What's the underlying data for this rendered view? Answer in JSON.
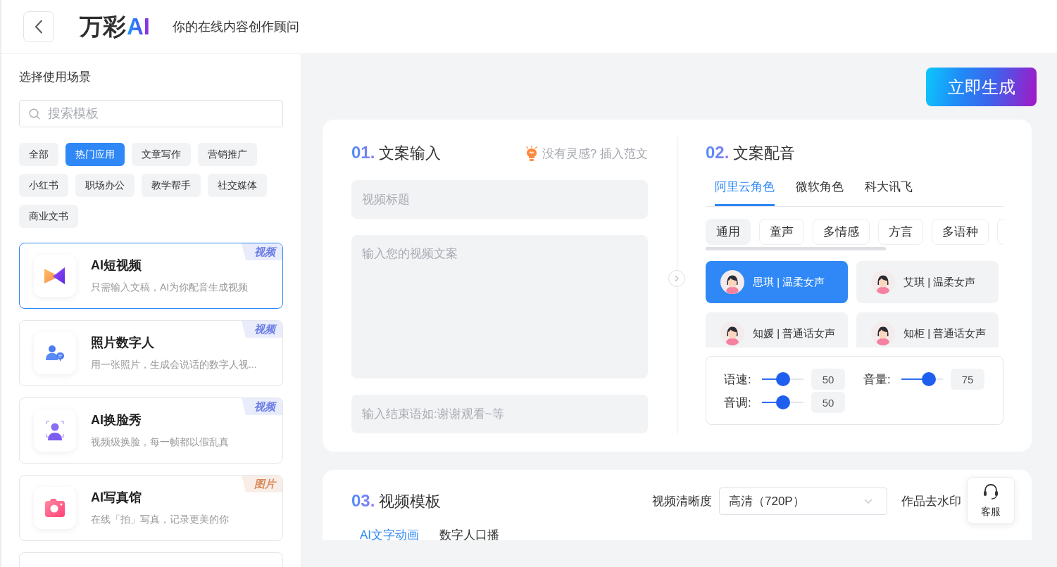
{
  "header": {
    "logo": {
      "name": "万彩",
      "mark": "AI"
    },
    "tagline": "你的在线内容创作顾问"
  },
  "sidebar": {
    "title": "选择使用场景",
    "search": {
      "placeholder": "搜索模板"
    },
    "filters": [
      {
        "label": "全部",
        "selected": false
      },
      {
        "label": "热门应用",
        "selected": true
      },
      {
        "label": "文章写作",
        "selected": false
      },
      {
        "label": "营销推广",
        "selected": false
      },
      {
        "label": "小红书",
        "selected": false
      },
      {
        "label": "职场办公",
        "selected": false
      },
      {
        "label": "教学帮手",
        "selected": false
      },
      {
        "label": "社交媒体",
        "selected": false
      },
      {
        "label": "商业文书",
        "selected": false
      }
    ],
    "templates": [
      {
        "title": "AI短视频",
        "description": "只需输入文稿，AI为你配音生成视频",
        "badge": {
          "text": "视频",
          "color": "#6a7de6"
        },
        "selected": true
      },
      {
        "title": "照片数字人",
        "description": "用一张照片，生成会说话的数字人视...",
        "badge": {
          "text": "视频",
          "color": "#6a7de6"
        },
        "selected": false
      },
      {
        "title": "AI换脸秀",
        "description": "视频级换脸，每一帧都以假乱真",
        "badge": {
          "text": "视频",
          "color": "#6a7de6"
        },
        "selected": false
      },
      {
        "title": "AI写真馆",
        "description": "在线「拍」写真，记录更美的你",
        "badge": {
          "text": "图片",
          "color": "#d98b5c"
        },
        "selected": false
      }
    ]
  },
  "generate_button": "立即生成",
  "copy_input": {
    "step": "01.",
    "title": "文案输入",
    "hint": "没有灵感? 插入范文",
    "fields": [
      {
        "kind": "input",
        "placeholder": "视频标题"
      },
      {
        "kind": "textarea",
        "placeholder": "输入您的视频文案"
      },
      {
        "kind": "input",
        "placeholder": "输入结束语如:谢谢观看~等"
      }
    ]
  },
  "dubbing": {
    "step": "02.",
    "title": "文案配音",
    "providers": [
      {
        "label": "阿里云角色",
        "selected": true
      },
      {
        "label": "微软角色",
        "selected": false
      },
      {
        "label": "科大讯飞",
        "selected": false
      }
    ],
    "categories": [
      {
        "label": "通用",
        "selected": true
      },
      {
        "label": "童声",
        "selected": false
      },
      {
        "label": "多情感",
        "selected": false
      },
      {
        "label": "方言",
        "selected": false
      },
      {
        "label": "多语种",
        "selected": false
      }
    ],
    "voices": [
      {
        "name": "思琪 | 温柔女声",
        "selected": true
      },
      {
        "name": "艾琪 | 温柔女声",
        "selected": false
      },
      {
        "name": "知媛 | 普通话女声",
        "selected": false
      },
      {
        "name": "知柜 | 普通话女声",
        "selected": false
      }
    ],
    "sliders": [
      {
        "label": "语速:",
        "level": 0.5,
        "value": "50"
      },
      {
        "label": "音量:",
        "level": 0.75,
        "value": "75"
      },
      {
        "label": "音调:",
        "level": 0.5,
        "value": "50"
      }
    ]
  },
  "video_template": {
    "step": "03.",
    "title": "视频模板",
    "resolution": {
      "label": "视频清晰度",
      "value": "高清（720P）"
    },
    "watermark_label": "作品去水印",
    "tabs": [
      {
        "label": "AI文字动画",
        "selected": true
      },
      {
        "label": "数字人口播",
        "selected": false
      }
    ]
  },
  "support_button": "客服"
}
